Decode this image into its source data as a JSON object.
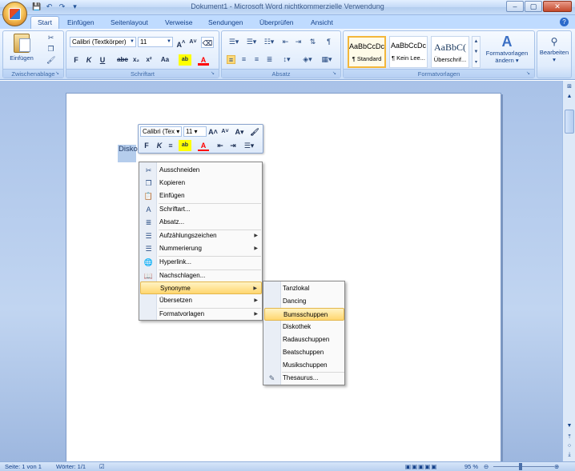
{
  "window": {
    "title": "Dokument1 - Microsoft Word nichtkommerzielle Verwendung",
    "controls": [
      "–",
      "▢",
      "✕"
    ]
  },
  "quick_access": [
    "save-icon",
    "undo-icon",
    "redo-icon",
    "customize-icon"
  ],
  "tabs": [
    {
      "label": "Start",
      "active": true
    },
    {
      "label": "Einfügen"
    },
    {
      "label": "Seitenlayout"
    },
    {
      "label": "Verweise"
    },
    {
      "label": "Sendungen"
    },
    {
      "label": "Überprüfen"
    },
    {
      "label": "Ansicht"
    }
  ],
  "ribbon": {
    "clipboard": {
      "paste_label": "Einfügen",
      "group_label": "Zwischenablage"
    },
    "font": {
      "font_name": "Calibri (Textkörper)",
      "font_size": "11",
      "group_label": "Schriftart",
      "buttons": [
        "F",
        "K",
        "U",
        "abc",
        "x₂",
        "x²",
        "Aa",
        "ab",
        "A"
      ]
    },
    "paragraph": {
      "group_label": "Absatz"
    },
    "styles": {
      "group_label": "Formatvorlagen",
      "items": [
        {
          "sample": "AaBbCcDc",
          "name": "¶ Standard"
        },
        {
          "sample": "AaBbCcDc",
          "name": "¶ Kein Lee..."
        },
        {
          "sample": "AaBbC(",
          "name": "Überschrif..."
        }
      ],
      "change_label_1": "Formatvorlagen",
      "change_label_2": "ändern ▾"
    },
    "editing": {
      "label": "Bearbeiten"
    }
  },
  "document": {
    "text": "Disko"
  },
  "mini_toolbar": {
    "font_name": "Calibri (Tex",
    "font_size": "11"
  },
  "context_menu": [
    {
      "label": "Ausschneiden",
      "icon": "cut-icon",
      "glyph": "✂"
    },
    {
      "label": "Kopieren",
      "icon": "copy-icon",
      "glyph": "❐"
    },
    {
      "label": "Einfügen",
      "icon": "paste-icon",
      "glyph": "📋"
    },
    {
      "label": "Schriftart...",
      "icon": "font-icon",
      "glyph": "A"
    },
    {
      "label": "Absatz...",
      "icon": "paragraph-icon",
      "glyph": "≣"
    },
    {
      "label": "Aufzählungszeichen",
      "icon": "bullets-icon",
      "glyph": "☰",
      "arrow": true
    },
    {
      "label": "Nummerierung",
      "icon": "numbering-icon",
      "glyph": "☰",
      "arrow": true
    },
    {
      "label": "Hyperlink...",
      "icon": "hyperlink-icon",
      "glyph": "🌐"
    },
    {
      "label": "Nachschlagen...",
      "icon": "research-icon",
      "glyph": "📖"
    },
    {
      "label": "Synonyme",
      "icon": "",
      "glyph": "",
      "arrow": true,
      "highlight": true
    },
    {
      "label": "Übersetzen",
      "icon": "",
      "glyph": "",
      "arrow": true
    },
    {
      "label": "Formatvorlagen",
      "icon": "",
      "glyph": "",
      "arrow": true
    }
  ],
  "synonyms_menu": [
    {
      "label": "Tanzlokal"
    },
    {
      "label": "Dancing"
    },
    {
      "label": "Bumsschuppen",
      "highlight": true
    },
    {
      "label": "Diskothek"
    },
    {
      "label": "Radauschuppen"
    },
    {
      "label": "Beatschuppen"
    },
    {
      "label": "Musikschuppen"
    },
    {
      "label": "Thesaurus...",
      "icon": "thesaurus-icon"
    }
  ],
  "status": {
    "page": "Seite: 1 von 1",
    "words": "Wörter: 1/1",
    "zoom": "95 %"
  },
  "colors": {
    "ribbon": "#bfdbff",
    "highlight": "#ffd66f",
    "highlight_bar": "#f3b73b",
    "font_color": "#ff0000"
  }
}
